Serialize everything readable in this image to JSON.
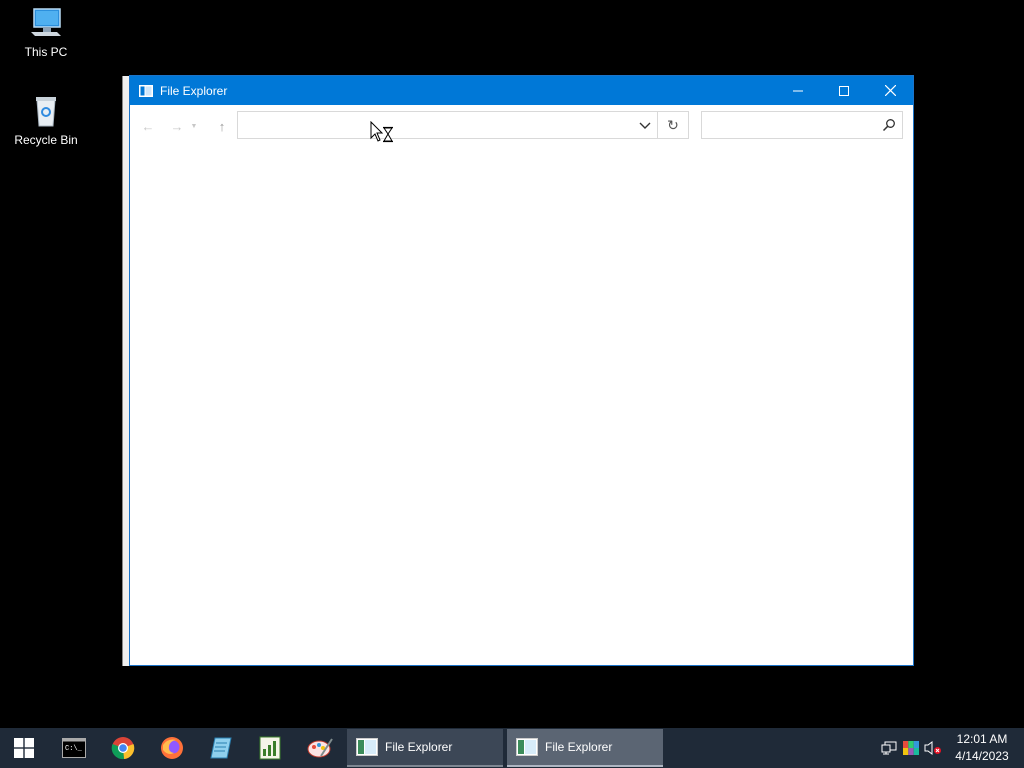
{
  "desktop": {
    "icons": [
      {
        "label": "This PC",
        "icon": "computer-icon"
      },
      {
        "label": "Recycle Bin",
        "icon": "recycle-bin-icon"
      }
    ]
  },
  "window": {
    "title": "File Explorer",
    "accent": "#0078d7",
    "address": {
      "value": "",
      "placeholder": ""
    },
    "search": {
      "value": "",
      "placeholder": ""
    },
    "cursor": "busy-cursor-icon"
  },
  "taskbar": {
    "background": "#1f2a38",
    "pinned": [
      "command-prompt-icon",
      "chrome-icon",
      "firefox-icon",
      "notepad-icon",
      "chart-app-icon",
      "paint-icon"
    ],
    "tasks": [
      {
        "label": "File Explorer",
        "active": false
      },
      {
        "label": "File Explorer",
        "active": true
      }
    ],
    "tray": [
      "network-icon",
      "color-display-icon",
      "volume-muted-icon"
    ],
    "clock": {
      "time": "12:01 AM",
      "date": "4/14/2023"
    }
  }
}
